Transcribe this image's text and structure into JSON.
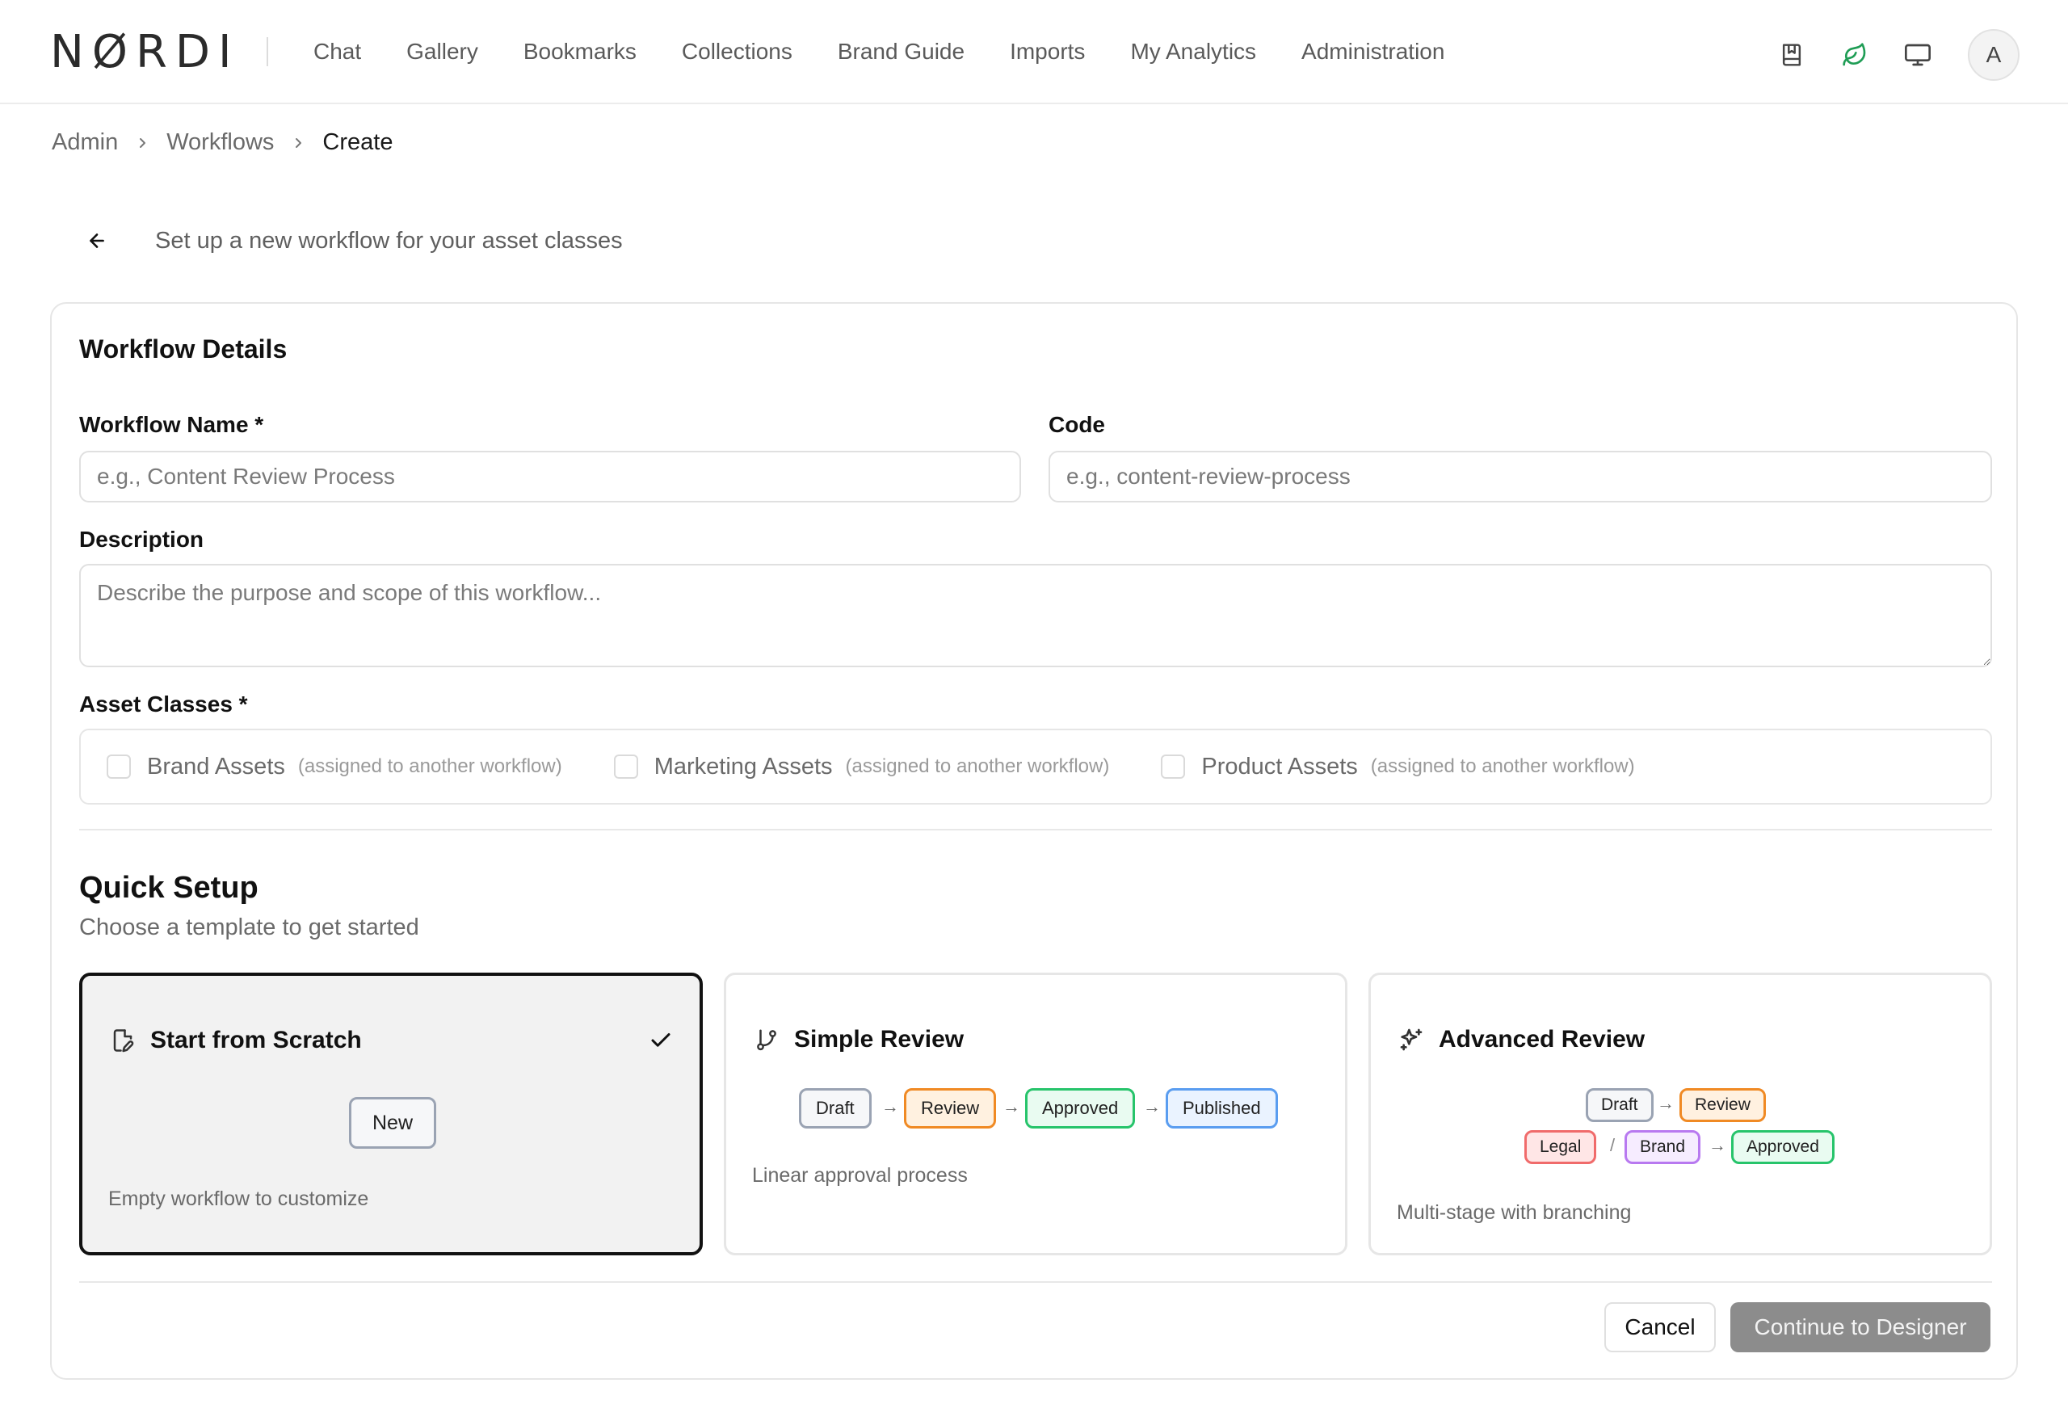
{
  "brand": {
    "logo_text": "NØRDI"
  },
  "nav": {
    "items": [
      {
        "label": "Chat"
      },
      {
        "label": "Gallery"
      },
      {
        "label": "Bookmarks"
      },
      {
        "label": "Collections"
      },
      {
        "label": "Brand Guide"
      },
      {
        "label": "Imports"
      },
      {
        "label": "My Analytics"
      },
      {
        "label": "Administration"
      }
    ]
  },
  "header_icons": [
    "book-icon",
    "leaf-icon",
    "monitor-icon"
  ],
  "user": {
    "avatar_initial": "A"
  },
  "breadcrumb": {
    "items": [
      "Admin",
      "Workflows",
      "Create"
    ]
  },
  "page": {
    "subtitle": "Set up a new workflow for your asset classes"
  },
  "form": {
    "section_title": "Workflow Details",
    "name": {
      "label": "Workflow Name *",
      "placeholder": "e.g., Content Review Process",
      "value": ""
    },
    "code": {
      "label": "Code",
      "placeholder": "e.g., content-review-process",
      "value": ""
    },
    "description": {
      "label": "Description",
      "placeholder": "Describe the purpose and scope of this workflow...",
      "value": ""
    },
    "asset_classes": {
      "label": "Asset Classes *",
      "options": [
        {
          "name": "Brand Assets",
          "note": "(assigned to another workflow)",
          "checked": false
        },
        {
          "name": "Marketing Assets",
          "note": "(assigned to another workflow)",
          "checked": false
        },
        {
          "name": "Product Assets",
          "note": "(assigned to another workflow)",
          "checked": false
        }
      ]
    }
  },
  "quick_setup": {
    "title": "Quick Setup",
    "subtitle": "Choose a template to get started",
    "templates": [
      {
        "title": "Start from Scratch",
        "description": "Empty workflow to customize",
        "selected": true,
        "preview": {
          "button": "New"
        }
      },
      {
        "title": "Simple Review",
        "description": "Linear approval process",
        "selected": false,
        "preview": {
          "stages": [
            "Draft",
            "Review",
            "Approved",
            "Published"
          ]
        }
      },
      {
        "title": "Advanced Review",
        "description": "Multi-stage with branching",
        "selected": false,
        "preview": {
          "row1": [
            "Draft",
            "Review"
          ],
          "row2": [
            "Legal",
            "Brand",
            "Approved"
          ],
          "separator": "/"
        }
      }
    ]
  },
  "actions": {
    "cancel": "Cancel",
    "continue": "Continue to Designer"
  },
  "colors": {
    "accent_green": "#1f9d55",
    "continue_disabled": "#8c8c8c",
    "chip_gray": "#9aa3b3",
    "chip_orange": "#f08a24",
    "chip_green": "#27c46b",
    "chip_blue": "#5a9df0",
    "chip_red": "#f06b6b",
    "chip_purple": "#b879f0"
  }
}
